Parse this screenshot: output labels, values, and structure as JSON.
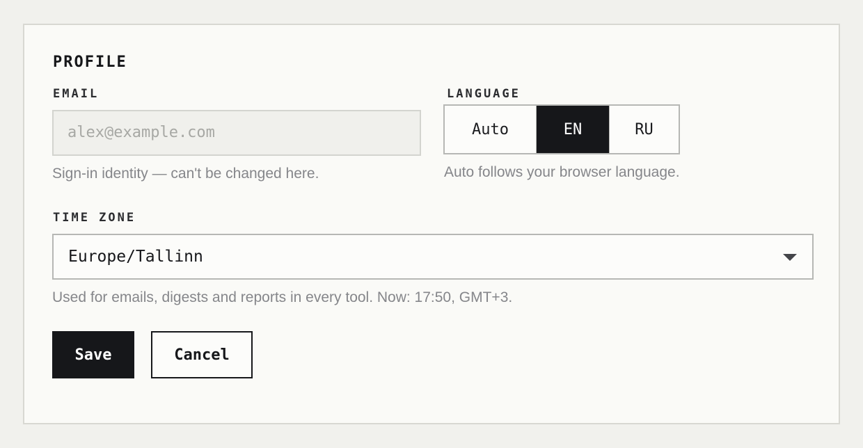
{
  "profile": {
    "section_title": "PROFILE",
    "email": {
      "label": "EMAIL",
      "placeholder": "alex@example.com",
      "value": "",
      "hint": "Sign-in identity — can't be changed here."
    },
    "language": {
      "label": "LANGUAGE",
      "options": [
        "Auto",
        "EN",
        "RU"
      ],
      "selected": "EN",
      "hint": "Auto follows your browser language."
    },
    "time_zone": {
      "label": "TIME ZONE",
      "value": "Europe/Tallinn",
      "hint": "Used for emails, digests and reports in every tool. Now: 17:50, GMT+3."
    },
    "actions": {
      "save_label": "Save",
      "cancel_label": "Cancel"
    }
  },
  "colors": {
    "page_background": "#f1f1ed",
    "card_background": "#fafaf7",
    "ink": "#16171a",
    "muted_text": "#85868a",
    "border": "#b6b7b4"
  },
  "icons": {
    "select_caret": "chevron-down-icon"
  }
}
